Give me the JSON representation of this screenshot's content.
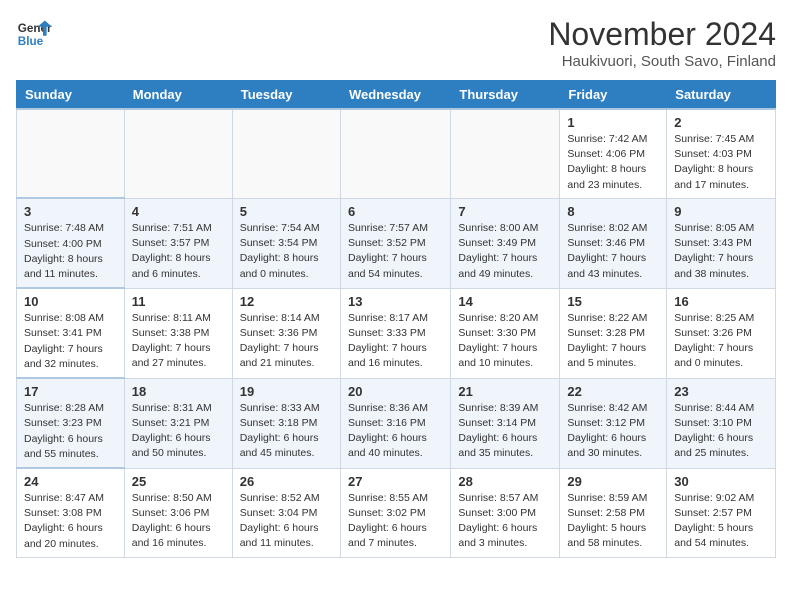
{
  "header": {
    "logo_line1": "General",
    "logo_line2": "Blue",
    "month_year": "November 2024",
    "location": "Haukivuori, South Savo, Finland"
  },
  "days_of_week": [
    "Sunday",
    "Monday",
    "Tuesday",
    "Wednesday",
    "Thursday",
    "Friday",
    "Saturday"
  ],
  "weeks": [
    {
      "cells": [
        {
          "day": null,
          "info": null
        },
        {
          "day": null,
          "info": null
        },
        {
          "day": null,
          "info": null
        },
        {
          "day": null,
          "info": null
        },
        {
          "day": null,
          "info": null
        },
        {
          "day": "1",
          "info": "Sunrise: 7:42 AM\nSunset: 4:06 PM\nDaylight: 8 hours\nand 23 minutes."
        },
        {
          "day": "2",
          "info": "Sunrise: 7:45 AM\nSunset: 4:03 PM\nDaylight: 8 hours\nand 17 minutes."
        }
      ]
    },
    {
      "cells": [
        {
          "day": "3",
          "info": "Sunrise: 7:48 AM\nSunset: 4:00 PM\nDaylight: 8 hours\nand 11 minutes."
        },
        {
          "day": "4",
          "info": "Sunrise: 7:51 AM\nSunset: 3:57 PM\nDaylight: 8 hours\nand 6 minutes."
        },
        {
          "day": "5",
          "info": "Sunrise: 7:54 AM\nSunset: 3:54 PM\nDaylight: 8 hours\nand 0 minutes."
        },
        {
          "day": "6",
          "info": "Sunrise: 7:57 AM\nSunset: 3:52 PM\nDaylight: 7 hours\nand 54 minutes."
        },
        {
          "day": "7",
          "info": "Sunrise: 8:00 AM\nSunset: 3:49 PM\nDaylight: 7 hours\nand 49 minutes."
        },
        {
          "day": "8",
          "info": "Sunrise: 8:02 AM\nSunset: 3:46 PM\nDaylight: 7 hours\nand 43 minutes."
        },
        {
          "day": "9",
          "info": "Sunrise: 8:05 AM\nSunset: 3:43 PM\nDaylight: 7 hours\nand 38 minutes."
        }
      ]
    },
    {
      "cells": [
        {
          "day": "10",
          "info": "Sunrise: 8:08 AM\nSunset: 3:41 PM\nDaylight: 7 hours\nand 32 minutes."
        },
        {
          "day": "11",
          "info": "Sunrise: 8:11 AM\nSunset: 3:38 PM\nDaylight: 7 hours\nand 27 minutes."
        },
        {
          "day": "12",
          "info": "Sunrise: 8:14 AM\nSunset: 3:36 PM\nDaylight: 7 hours\nand 21 minutes."
        },
        {
          "day": "13",
          "info": "Sunrise: 8:17 AM\nSunset: 3:33 PM\nDaylight: 7 hours\nand 16 minutes."
        },
        {
          "day": "14",
          "info": "Sunrise: 8:20 AM\nSunset: 3:30 PM\nDaylight: 7 hours\nand 10 minutes."
        },
        {
          "day": "15",
          "info": "Sunrise: 8:22 AM\nSunset: 3:28 PM\nDaylight: 7 hours\nand 5 minutes."
        },
        {
          "day": "16",
          "info": "Sunrise: 8:25 AM\nSunset: 3:26 PM\nDaylight: 7 hours\nand 0 minutes."
        }
      ]
    },
    {
      "cells": [
        {
          "day": "17",
          "info": "Sunrise: 8:28 AM\nSunset: 3:23 PM\nDaylight: 6 hours\nand 55 minutes."
        },
        {
          "day": "18",
          "info": "Sunrise: 8:31 AM\nSunset: 3:21 PM\nDaylight: 6 hours\nand 50 minutes."
        },
        {
          "day": "19",
          "info": "Sunrise: 8:33 AM\nSunset: 3:18 PM\nDaylight: 6 hours\nand 45 minutes."
        },
        {
          "day": "20",
          "info": "Sunrise: 8:36 AM\nSunset: 3:16 PM\nDaylight: 6 hours\nand 40 minutes."
        },
        {
          "day": "21",
          "info": "Sunrise: 8:39 AM\nSunset: 3:14 PM\nDaylight: 6 hours\nand 35 minutes."
        },
        {
          "day": "22",
          "info": "Sunrise: 8:42 AM\nSunset: 3:12 PM\nDaylight: 6 hours\nand 30 minutes."
        },
        {
          "day": "23",
          "info": "Sunrise: 8:44 AM\nSunset: 3:10 PM\nDaylight: 6 hours\nand 25 minutes."
        }
      ]
    },
    {
      "cells": [
        {
          "day": "24",
          "info": "Sunrise: 8:47 AM\nSunset: 3:08 PM\nDaylight: 6 hours\nand 20 minutes."
        },
        {
          "day": "25",
          "info": "Sunrise: 8:50 AM\nSunset: 3:06 PM\nDaylight: 6 hours\nand 16 minutes."
        },
        {
          "day": "26",
          "info": "Sunrise: 8:52 AM\nSunset: 3:04 PM\nDaylight: 6 hours\nand 11 minutes."
        },
        {
          "day": "27",
          "info": "Sunrise: 8:55 AM\nSunset: 3:02 PM\nDaylight: 6 hours\nand 7 minutes."
        },
        {
          "day": "28",
          "info": "Sunrise: 8:57 AM\nSunset: 3:00 PM\nDaylight: 6 hours\nand 3 minutes."
        },
        {
          "day": "29",
          "info": "Sunrise: 8:59 AM\nSunset: 2:58 PM\nDaylight: 5 hours\nand 58 minutes."
        },
        {
          "day": "30",
          "info": "Sunrise: 9:02 AM\nSunset: 2:57 PM\nDaylight: 5 hours\nand 54 minutes."
        }
      ]
    }
  ]
}
